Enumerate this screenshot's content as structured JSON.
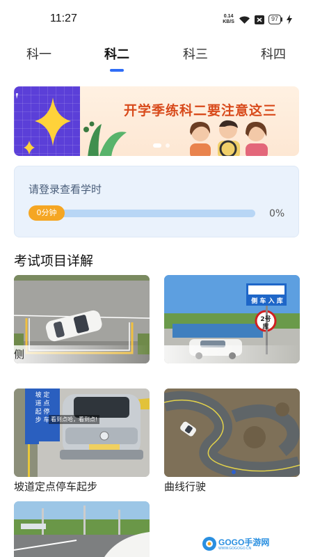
{
  "status": {
    "time": "11:27",
    "net_speed_value": "0.14",
    "net_speed_unit": "KB/S",
    "battery": "97"
  },
  "tabs": [
    {
      "label": "科一"
    },
    {
      "label": "科二"
    },
    {
      "label": "科三"
    },
    {
      "label": "科四"
    }
  ],
  "active_tab": "科二",
  "banner": {
    "title": "开学季练科二要注意这三"
  },
  "study": {
    "title": "请登录查看学时",
    "time_label": "0分钟",
    "percent": "0%",
    "progress": 0
  },
  "section_title": "考试项目详解",
  "items": [
    {
      "label": "侧"
    },
    {
      "label": ""
    },
    {
      "label": "坡道定点停车起步"
    },
    {
      "label": "曲线行驶"
    },
    {
      "label": ""
    }
  ],
  "thumb_text": {
    "sign_line1": "侧 车 入 库",
    "sign_line2": "2号",
    "sign_line3": "库",
    "slope_sign": "坡 定\n道 点\n起 停\n步 车",
    "slope_caption": "看到点哈，看到点!"
  },
  "watermark": {
    "text": "GOGO手游网",
    "url": "WWW.GOGOGO.CN"
  },
  "colors": {
    "accent": "#2f6df6",
    "pill": "#f5a623",
    "banner_text": "#d84a1b",
    "card_bg": "#eaf2fc"
  }
}
